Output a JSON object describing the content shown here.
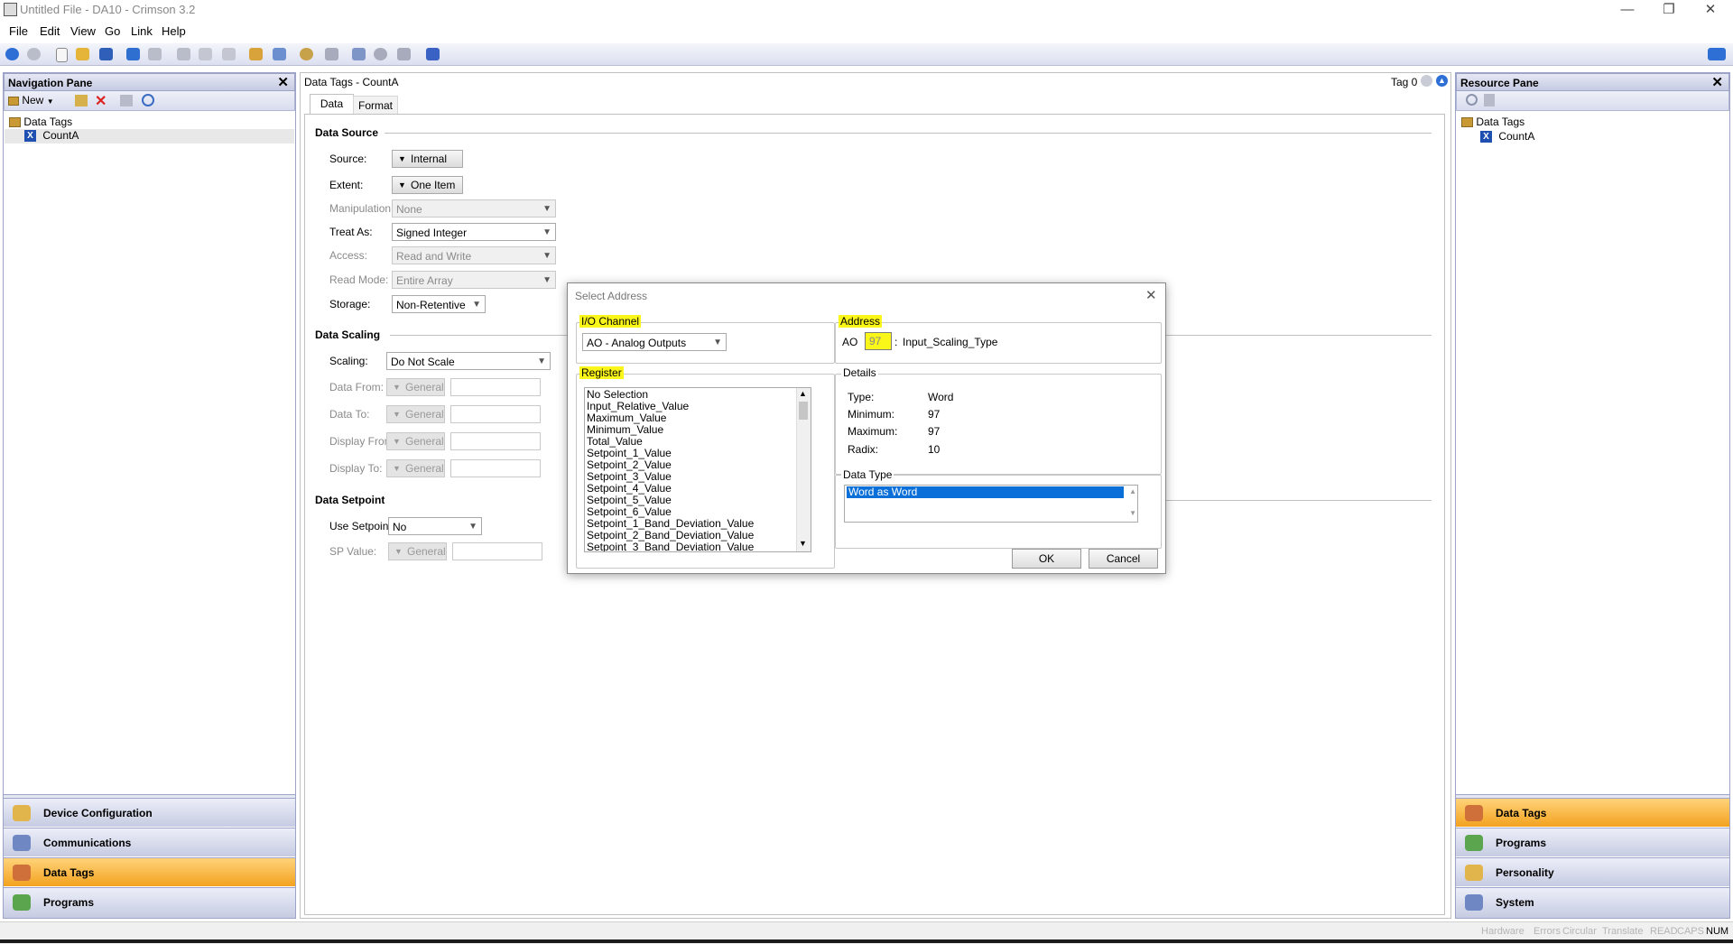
{
  "window": {
    "title": "Untitled File - DA10 - Crimson 3.2"
  },
  "menu": [
    "File",
    "Edit",
    "View",
    "Go",
    "Link",
    "Help"
  ],
  "nav_pane": {
    "title": "Navigation Pane",
    "new_label": "New",
    "tree": {
      "root": "Data Tags",
      "child": "CountA"
    },
    "buttons": [
      "Device Configuration",
      "Communications",
      "Data Tags",
      "Programs"
    ],
    "active": "Data Tags"
  },
  "editor": {
    "title": "Data Tags - CountA",
    "tag_counter": "Tag 0",
    "tabs": [
      "Data",
      "Format"
    ],
    "data_source": {
      "heading": "Data Source",
      "source_label": "Source:",
      "source_value": "Internal",
      "extent_label": "Extent:",
      "extent_value": "One Item",
      "manipulation_label": "Manipulation:",
      "manipulation_value": "None",
      "treat_label": "Treat As:",
      "treat_value": "Signed Integer",
      "access_label": "Access:",
      "access_value": "Read and Write",
      "readmode_label": "Read Mode:",
      "readmode_value": "Entire Array",
      "storage_label": "Storage:",
      "storage_value": "Non-Retentive"
    },
    "data_scaling": {
      "heading": "Data Scaling",
      "scaling_label": "Scaling:",
      "scaling_value": "Do Not Scale",
      "rows": [
        {
          "label": "Data From:",
          "value": "General"
        },
        {
          "label": "Data To:",
          "value": "General"
        },
        {
          "label": "Display From:",
          "value": "General"
        },
        {
          "label": "Display To:",
          "value": "General"
        }
      ]
    },
    "data_setpoint": {
      "heading": "Data Setpoint",
      "use_label": "Use Setpoint:",
      "use_value": "No",
      "sp_label": "SP Value:",
      "sp_value": "General"
    }
  },
  "resource_pane": {
    "title": "Resource Pane",
    "tree": {
      "root": "Data Tags",
      "child": "CountA"
    },
    "buttons": [
      "Data Tags",
      "Programs",
      "Personality",
      "System"
    ],
    "active": "Data Tags"
  },
  "dialog": {
    "title": "Select Address",
    "io_channel": {
      "label": "I/O Channel",
      "value": "AO - Analog Outputs"
    },
    "address": {
      "label": "Address",
      "prefix": "AO",
      "value": "97",
      "separator": ":",
      "name": "Input_Scaling_Type"
    },
    "register": {
      "label": "Register",
      "items": [
        "No Selection",
        "Input_Relative_Value",
        "Maximum_Value",
        "Minimum_Value",
        "Total_Value",
        "Setpoint_1_Value",
        "Setpoint_2_Value",
        "Setpoint_3_Value",
        "Setpoint_4_Value",
        "Setpoint_5_Value",
        "Setpoint_6_Value",
        "Setpoint_1_Band_Deviation_Value",
        "Setpoint_2_Band_Deviation_Value",
        "Setpoint_3_Band_Deviation_Value"
      ]
    },
    "details": {
      "label": "Details",
      "type_label": "Type:",
      "type_value": "Word",
      "min_label": "Minimum:",
      "min_value": "97",
      "max_label": "Maximum:",
      "max_value": "97",
      "radix_label": "Radix:",
      "radix_value": "10"
    },
    "data_type": {
      "label": "Data Type",
      "selected": "Word as Word"
    },
    "ok": "OK",
    "cancel": "Cancel"
  },
  "status": [
    "Hardware",
    "Errors",
    "Circular",
    "Translate",
    "READ",
    "CAPS",
    "NUM"
  ],
  "colors": {
    "highlight": "#fbf61a",
    "selection": "#0a6fd8",
    "active_nav": "#f3a21f"
  }
}
